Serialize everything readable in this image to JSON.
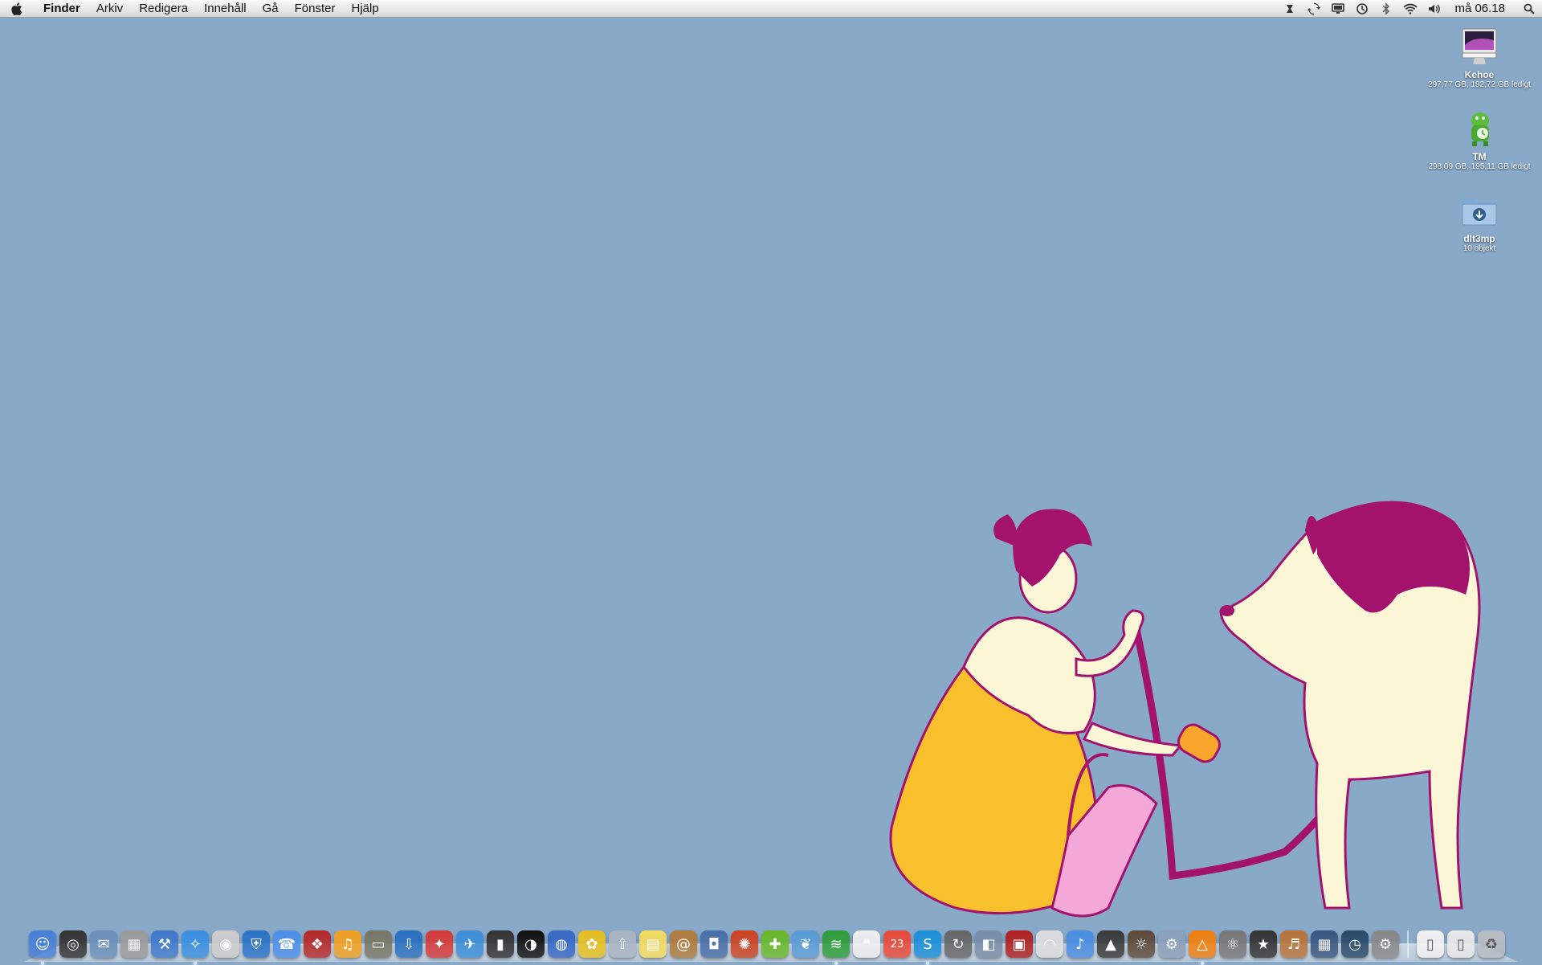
{
  "menubar": {
    "app_name": "Finder",
    "items": [
      "Arkiv",
      "Redigera",
      "Innehåll",
      "Gå",
      "Fönster",
      "Hjälp"
    ],
    "status_icons": [
      "transmit-icon",
      "sync-icon",
      "display-icon",
      "time-machine-icon",
      "bluetooth-icon",
      "wifi-icon",
      "volume-icon"
    ],
    "clock": "må 06.18"
  },
  "desktop": {
    "icons": [
      {
        "name": "Kehoe",
        "info": "297,77 GB, 192,72 GB ledigt",
        "icon": "imac-drive-icon"
      },
      {
        "name": "TM",
        "info": "298,09 GB, 195,11 GB ledigt",
        "icon": "time-machine-drive-icon"
      },
      {
        "name": "dlt3mp",
        "info": "10 objekt",
        "icon": "downloads-folder-icon"
      }
    ]
  },
  "dock": {
    "apps": [
      {
        "icon": "finder-icon",
        "color": "#4a7fd6",
        "glyph": "☺",
        "running": true
      },
      {
        "icon": "dashboard-icon",
        "color": "#333333",
        "glyph": "◎",
        "running": false
      },
      {
        "icon": "mail-icon",
        "color": "#6b8fb8",
        "glyph": "✉",
        "running": false
      },
      {
        "icon": "calculator-icon",
        "color": "#9a9a9a",
        "glyph": "▦",
        "running": false
      },
      {
        "icon": "xcode-icon",
        "color": "#3f78c9",
        "glyph": "⚒",
        "running": false
      },
      {
        "icon": "safari-icon",
        "color": "#3a8fe0",
        "glyph": "✧",
        "running": true
      },
      {
        "icon": "dvd-player-icon",
        "color": "#cccccc",
        "glyph": "◉",
        "running": false
      },
      {
        "icon": "shield-icon",
        "color": "#2b73c7",
        "glyph": "⛨",
        "running": false
      },
      {
        "icon": "ichat-icon",
        "color": "#4d8fe8",
        "glyph": "☎",
        "running": false
      },
      {
        "icon": "growl-icon",
        "color": "#b52a2a",
        "glyph": "❖",
        "running": false
      },
      {
        "icon": "audacity-icon",
        "color": "#f0a020",
        "glyph": "♫",
        "running": false
      },
      {
        "icon": "drive-icon",
        "color": "#777766",
        "glyph": "▭",
        "running": false
      },
      {
        "icon": "transmit-icon",
        "color": "#2a6fbf",
        "glyph": "⇩",
        "running": false
      },
      {
        "icon": "red-app-icon",
        "color": "#d53a3a",
        "glyph": "✦",
        "running": false
      },
      {
        "icon": "twitter-icon",
        "color": "#3d8fd8",
        "glyph": "✈",
        "running": false
      },
      {
        "icon": "film-icon",
        "color": "#333333",
        "glyph": "▮",
        "running": false
      },
      {
        "icon": "live-icon",
        "color": "#111111",
        "glyph": "◑",
        "running": false
      },
      {
        "icon": "firefox-icon",
        "color": "#3868c4",
        "glyph": "◍",
        "running": false
      },
      {
        "icon": "cyberduck-icon",
        "color": "#e8c020",
        "glyph": "✿",
        "running": false
      },
      {
        "icon": "flickr-uploader-icon",
        "color": "#aab4c2",
        "glyph": "⇧",
        "running": false
      },
      {
        "icon": "stickies-icon",
        "color": "#f3dc60",
        "glyph": "▤",
        "running": false
      },
      {
        "icon": "address-book-icon",
        "color": "#b07a3c",
        "glyph": "@",
        "running": false
      },
      {
        "icon": "ipod-icon",
        "color": "#4a6ea8",
        "glyph": "◘",
        "running": false
      },
      {
        "icon": "hairdryer-icon",
        "color": "#cc4422",
        "glyph": "✺",
        "running": false
      },
      {
        "icon": "green-app-icon",
        "color": "#6ab82a",
        "glyph": "✚",
        "running": false
      },
      {
        "icon": "fish-icon",
        "color": "#5a9bd5",
        "glyph": "❦",
        "running": false
      },
      {
        "icon": "spotify-icon",
        "color": "#2f9e3a",
        "glyph": "≋",
        "running": true
      },
      {
        "icon": "speech-bubble-icon",
        "color": "#eeeeee",
        "glyph": "❝",
        "running": false
      },
      {
        "icon": "ical-icon",
        "color": "#e84a3a",
        "glyph": "23",
        "running": false
      },
      {
        "icon": "skype-icon",
        "color": "#1d8fd8",
        "glyph": "S",
        "running": true
      },
      {
        "icon": "sync-icon",
        "color": "#666666",
        "glyph": "↻",
        "running": false
      },
      {
        "icon": "preview-icon",
        "color": "#7a8ea6",
        "glyph": "◧",
        "running": false
      },
      {
        "icon": "photo-booth-icon",
        "color": "#b02020",
        "glyph": "▣",
        "running": false
      },
      {
        "icon": "airport-icon",
        "color": "#dddddd",
        "glyph": "◠",
        "running": false
      },
      {
        "icon": "itunes-icon",
        "color": "#4a8de0",
        "glyph": "♪",
        "running": false
      },
      {
        "icon": "activity-monitor-icon",
        "color": "#3a3a3a",
        "glyph": "▲",
        "running": false
      },
      {
        "icon": "iphoto-icon",
        "color": "#5d4a3a",
        "glyph": "☼",
        "running": false
      },
      {
        "icon": "utilities-icon",
        "color": "#8aa0b8",
        "glyph": "⚙",
        "running": false
      },
      {
        "icon": "vlc-icon",
        "color": "#f08010",
        "glyph": "△",
        "running": true
      },
      {
        "icon": "automator-icon",
        "color": "#777777",
        "glyph": "⚛",
        "running": false
      },
      {
        "icon": "imovie-icon",
        "color": "#333333",
        "glyph": "★",
        "running": false
      },
      {
        "icon": "garageband-icon",
        "color": "#b8743a",
        "glyph": "♬",
        "running": false
      },
      {
        "icon": "spaces-icon",
        "color": "#3a5680",
        "glyph": "▦",
        "running": false
      },
      {
        "icon": "time-machine-icon",
        "color": "#2a4a6a",
        "glyph": "◷",
        "running": false
      },
      {
        "icon": "system-preferences-icon",
        "color": "#888888",
        "glyph": "⚙",
        "running": false
      }
    ],
    "stacks": [
      {
        "icon": "document-stack-icon",
        "color": "#f2f2f2",
        "glyph": "▯"
      },
      {
        "icon": "downloads-stack-icon",
        "color": "#e8e8e8",
        "glyph": "▯"
      },
      {
        "icon": "trash-icon",
        "color": "#b8bcc2",
        "glyph": "♻"
      }
    ]
  }
}
